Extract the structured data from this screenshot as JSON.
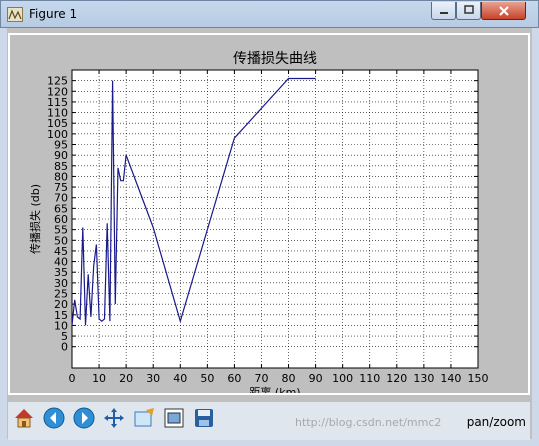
{
  "window": {
    "title": "Figure 1"
  },
  "toolbar": {
    "mode_text": "pan/zoom"
  },
  "watermark": "http://blog.csdn.net/mmc2",
  "chart_data": {
    "type": "line",
    "title": "传播损失曲线",
    "xlabel": "距离 (km)",
    "ylabel": "传播损失 (db)",
    "xlim": [
      0,
      150
    ],
    "ylim": [
      -10,
      130
    ],
    "xticks": [
      0,
      10,
      20,
      30,
      40,
      50,
      60,
      70,
      80,
      90,
      100,
      110,
      120,
      130,
      140,
      150
    ],
    "yticks": [
      0,
      5,
      10,
      15,
      20,
      25,
      30,
      35,
      40,
      45,
      50,
      55,
      60,
      65,
      70,
      75,
      80,
      85,
      90,
      95,
      100,
      105,
      110,
      115,
      120,
      125
    ],
    "grid": true,
    "series": [
      {
        "color": "#1a1a8c",
        "x": [
          0,
          1,
          2,
          3,
          4,
          5,
          6,
          7,
          8,
          9,
          10,
          11,
          12,
          13,
          14,
          15,
          16,
          17,
          18,
          19,
          20,
          30,
          40,
          60,
          80,
          90
        ],
        "y": [
          10,
          22,
          14,
          13,
          56,
          10,
          34,
          14,
          38,
          48,
          13,
          12,
          13,
          58,
          12,
          125,
          20,
          84,
          78,
          78,
          90,
          56,
          12,
          98,
          126,
          126
        ]
      }
    ]
  }
}
